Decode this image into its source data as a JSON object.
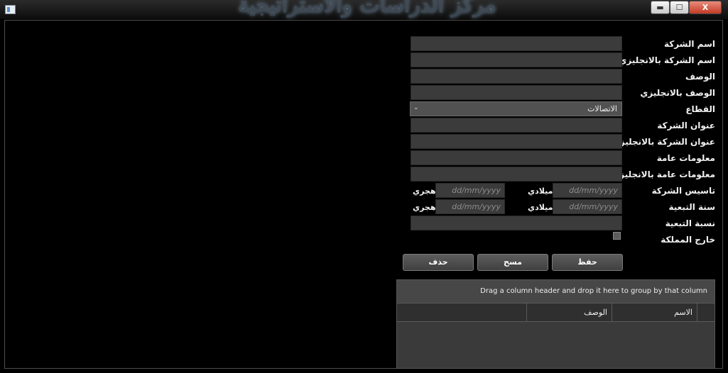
{
  "window": {
    "title_banner": "مركز الدراسات والاستراتيجية",
    "min_symbol": "▬",
    "max_symbol": "☐",
    "close_symbol": "X"
  },
  "form": {
    "labels": {
      "company_name": "اسم الشركة",
      "company_name_en": "اسم الشركة بالانجليزي",
      "description": "الوصف",
      "description_en": "الوصف بالانجليزي",
      "sector": "القطاع",
      "company_address": "عنوان الشركة",
      "company_address_en": "عنوان الشركة بالانجليزية",
      "general_info": "معلومات عامة",
      "general_info_en": "معلومات عامة بالانجليزية",
      "founding": "تاسيس الشركة",
      "affiliation_year": "سنة التبعية",
      "affiliation_percent": "نسبة التبعية",
      "outside_kingdom": "خارج المملكة"
    },
    "sector_value": "الاتصالات",
    "date_placeholder": "dd/mm/yyyy",
    "gregorian": "ميلادي",
    "hijri": "هجري"
  },
  "actions": {
    "save": "حفظ",
    "clear": "مسح",
    "delete": "حذف"
  },
  "grid": {
    "group_hint": "Drag a column header and drop it here to group by that column",
    "columns": [
      "الاسم",
      "الوصف"
    ]
  }
}
